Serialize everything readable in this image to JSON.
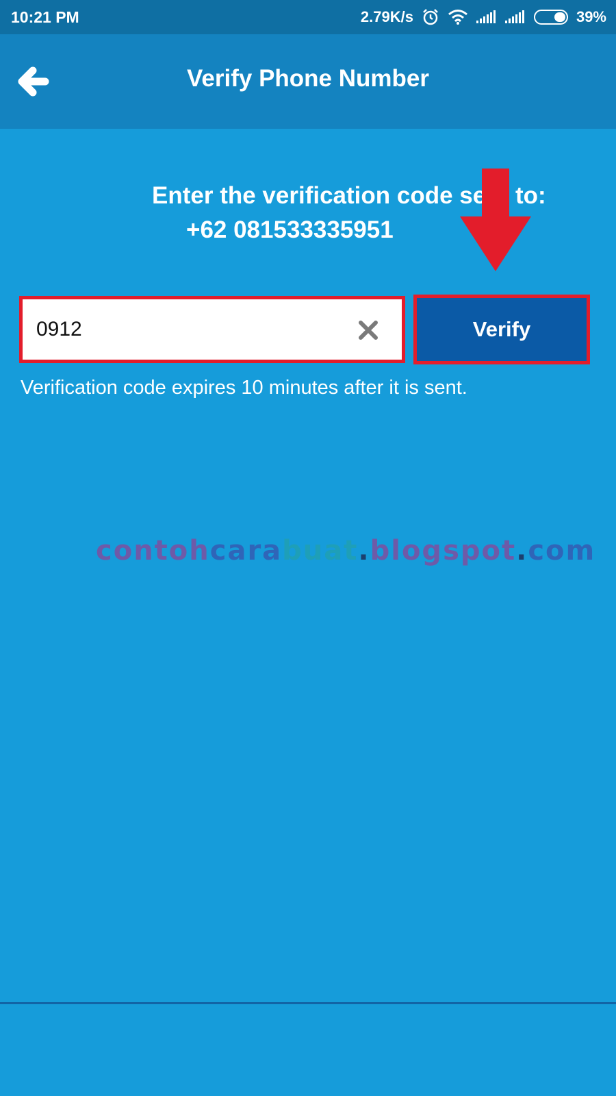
{
  "status_bar": {
    "time": "10:21 PM",
    "network_speed": "2.79K/s",
    "battery_percent": "39%",
    "battery_level": 0.39,
    "icons": [
      "alarm-icon",
      "wifi-icon",
      "signal-icon",
      "signal-icon",
      "battery-icon"
    ]
  },
  "app_bar": {
    "title": "Verify Phone Number",
    "back_icon": "back-arrow-icon"
  },
  "content": {
    "prompt": "Enter the verification code sent to:",
    "phone_number": "+62 081533335951",
    "code_input": {
      "value": "0912"
    },
    "verify_label": "Verify",
    "expiry_note": "Verification code expires 10 minutes after it is sent."
  },
  "watermark": {
    "part1": "contoh",
    "part2": "cara",
    "part3": "buat",
    "part4": ".",
    "part5": "blogspot",
    "part6": ".",
    "part7": "com"
  },
  "colors": {
    "background": "#169cda",
    "app_bar": "#1483c0",
    "status_bar": "#0f6fa3",
    "verify_button": "#0b5aa6",
    "highlight": "#e31d2b"
  }
}
